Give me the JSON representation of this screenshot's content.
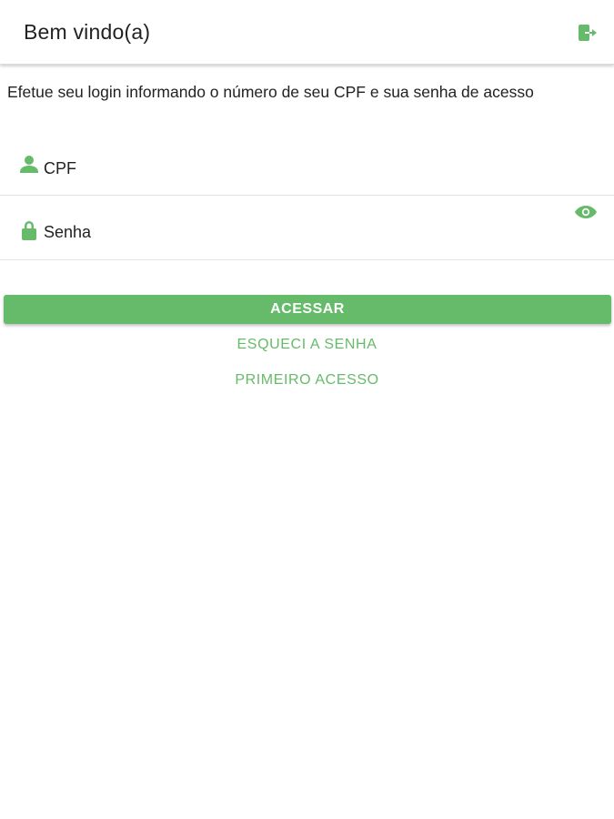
{
  "header": {
    "title": "Bem vindo(a)",
    "logout_icon": "logout-icon"
  },
  "intro_text": "Efetue seu login informando o número de seu CPF e sua senha de acesso",
  "form": {
    "cpf": {
      "icon": "person-icon",
      "placeholder": "CPF",
      "value": ""
    },
    "senha": {
      "icon": "lock-icon",
      "placeholder": "Senha",
      "value": "",
      "toggle_icon": "eye-icon"
    }
  },
  "actions": {
    "login_label": "ACESSAR",
    "forgot_password_label": "ESQUECI A SENHA",
    "first_access_label": "PRIMEIRO ACESSO"
  },
  "colors": {
    "accent": "#66bb6a",
    "text": "#222222",
    "background": "#ffffff",
    "divider": "#e3e3e3"
  }
}
